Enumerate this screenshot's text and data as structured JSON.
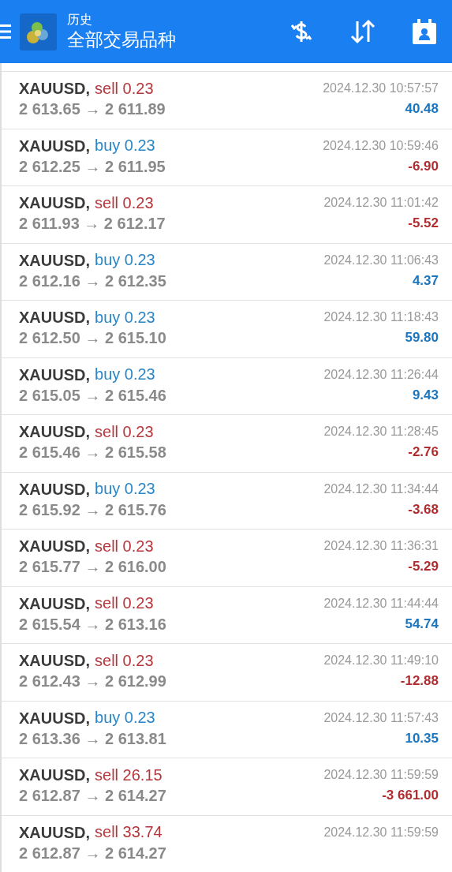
{
  "header": {
    "title": "历史",
    "subtitle": "全部交易品种"
  },
  "deals": [
    {
      "symbol": "XAUUSD,",
      "order": "sell 0.23",
      "kind": "sell",
      "prices": "2 613.65 → 2 611.89",
      "time": "2024.12.30 10:57:57",
      "profit": "40.48",
      "negative": false
    },
    {
      "symbol": "XAUUSD,",
      "order": "buy 0.23",
      "kind": "buy",
      "prices": "2 612.25 → 2 611.95",
      "time": "2024.12.30 10:59:46",
      "profit": "-6.90",
      "negative": true
    },
    {
      "symbol": "XAUUSD,",
      "order": "sell 0.23",
      "kind": "sell",
      "prices": "2 611.93 → 2 612.17",
      "time": "2024.12.30 11:01:42",
      "profit": "-5.52",
      "negative": true
    },
    {
      "symbol": "XAUUSD,",
      "order": "buy 0.23",
      "kind": "buy",
      "prices": "2 612.16 → 2 612.35",
      "time": "2024.12.30 11:06:43",
      "profit": "4.37",
      "negative": false
    },
    {
      "symbol": "XAUUSD,",
      "order": "buy 0.23",
      "kind": "buy",
      "prices": "2 612.50 → 2 615.10",
      "time": "2024.12.30 11:18:43",
      "profit": "59.80",
      "negative": false
    },
    {
      "symbol": "XAUUSD,",
      "order": "buy 0.23",
      "kind": "buy",
      "prices": "2 615.05 → 2 615.46",
      "time": "2024.12.30 11:26:44",
      "profit": "9.43",
      "negative": false
    },
    {
      "symbol": "XAUUSD,",
      "order": "sell 0.23",
      "kind": "sell",
      "prices": "2 615.46 → 2 615.58",
      "time": "2024.12.30 11:28:45",
      "profit": "-2.76",
      "negative": true
    },
    {
      "symbol": "XAUUSD,",
      "order": "buy 0.23",
      "kind": "buy",
      "prices": "2 615.92 → 2 615.76",
      "time": "2024.12.30 11:34:44",
      "profit": "-3.68",
      "negative": true
    },
    {
      "symbol": "XAUUSD,",
      "order": "sell 0.23",
      "kind": "sell",
      "prices": "2 615.77 → 2 616.00",
      "time": "2024.12.30 11:36:31",
      "profit": "-5.29",
      "negative": true
    },
    {
      "symbol": "XAUUSD,",
      "order": "sell 0.23",
      "kind": "sell",
      "prices": "2 615.54 → 2 613.16",
      "time": "2024.12.30 11:44:44",
      "profit": "54.74",
      "negative": false
    },
    {
      "symbol": "XAUUSD,",
      "order": "sell 0.23",
      "kind": "sell",
      "prices": "2 612.43 → 2 612.99",
      "time": "2024.12.30 11:49:10",
      "profit": "-12.88",
      "negative": true
    },
    {
      "symbol": "XAUUSD,",
      "order": "buy 0.23",
      "kind": "buy",
      "prices": "2 613.36 → 2 613.81",
      "time": "2024.12.30 11:57:43",
      "profit": "10.35",
      "negative": false
    },
    {
      "symbol": "XAUUSD,",
      "order": "sell 26.15",
      "kind": "sell",
      "prices": "2 612.87 → 2 614.27",
      "time": "2024.12.30 11:59:59",
      "profit": "-3 661.00",
      "negative": true
    },
    {
      "symbol": "XAUUSD,",
      "order": "sell 33.74",
      "kind": "sell",
      "prices": "2 612.87 → 2 614.27",
      "time": "2024.12.30 11:59:59"
    }
  ]
}
